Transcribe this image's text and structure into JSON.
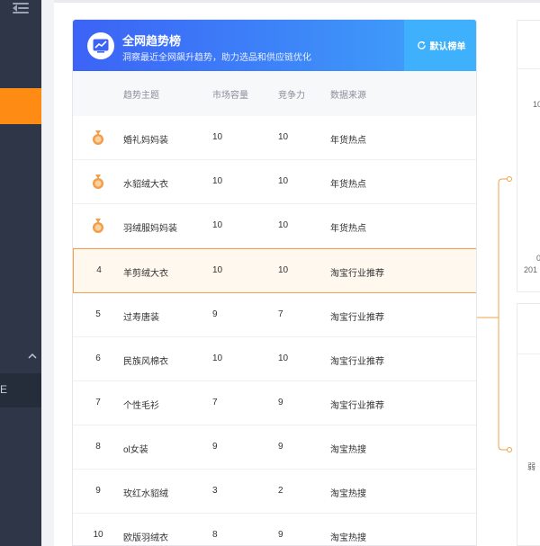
{
  "card": {
    "title": "全网趋势榜",
    "subtitle": "洞察最近全网飙升趋势，助力选品和供应链优化",
    "default_button": "默认榜单"
  },
  "columns": {
    "topic": "趋势主题",
    "capacity": "市场容量",
    "competition": "竞争力",
    "source": "数据来源"
  },
  "rows": [
    {
      "rank": "1",
      "topic": "婚礼妈妈装",
      "capacity": "10",
      "competition": "10",
      "source": "年货热点"
    },
    {
      "rank": "2",
      "topic": "水貂绒大衣",
      "capacity": "10",
      "competition": "10",
      "source": "年货热点"
    },
    {
      "rank": "3",
      "topic": "羽绒服妈妈装",
      "capacity": "10",
      "competition": "10",
      "source": "年货热点"
    },
    {
      "rank": "4",
      "topic": "羊剪绒大衣",
      "capacity": "10",
      "competition": "10",
      "source": "淘宝行业推荐"
    },
    {
      "rank": "5",
      "topic": "过寿唐装",
      "capacity": "9",
      "competition": "7",
      "source": "淘宝行业推荐"
    },
    {
      "rank": "6",
      "topic": "民族风棉衣",
      "capacity": "10",
      "competition": "10",
      "source": "淘宝行业推荐"
    },
    {
      "rank": "7",
      "topic": "个性毛衫",
      "capacity": "7",
      "competition": "9",
      "source": "淘宝行业推荐"
    },
    {
      "rank": "8",
      "topic": "ol女装",
      "capacity": "9",
      "competition": "9",
      "source": "淘宝热搜"
    },
    {
      "rank": "9",
      "topic": "玫红水貂绒",
      "capacity": "3",
      "competition": "2",
      "source": "淘宝热搜"
    },
    {
      "rank": "10",
      "topic": "欧版羽绒衣",
      "capacity": "8",
      "competition": "9",
      "source": "淘宝热搜"
    }
  ],
  "right_panel": {
    "axis_top": "10",
    "axis_zero": "0",
    "axis_year": "201",
    "weak_label": "弱"
  },
  "sidebar": {
    "sub_item_text": "E"
  },
  "colors": {
    "accent_orange": "#fd8b14",
    "header_blue": "#3c63f6",
    "button_blue": "#3fb0fb",
    "sidebar": "#2e3647"
  },
  "icons": {
    "menu": "menu-fold-icon",
    "trend": "trend-chart-icon",
    "refresh": "refresh-icon",
    "medal": "medal-icon",
    "chevron": "chevron-up-icon"
  }
}
